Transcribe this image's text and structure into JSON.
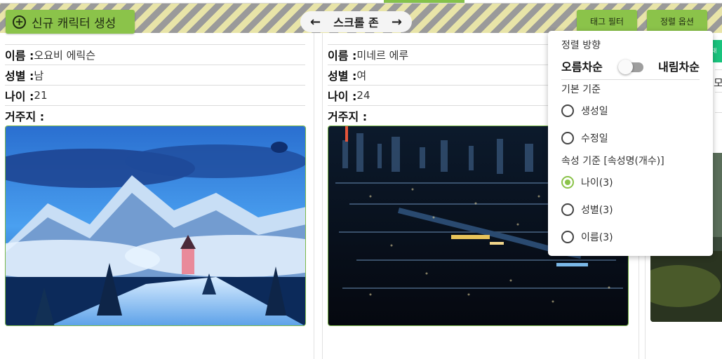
{
  "toolbar": {
    "new_character_label": "신규 캐릭터 생성",
    "scroll_zone_label": "스크롤 존",
    "tag_filter_label": "태그 필터",
    "sort_options_label": "정렬 옵션"
  },
  "cards": [
    {
      "name_label": "이름 :",
      "name_value": "오요비 에릭슨",
      "gender_label": "성별 :",
      "gender_value": "남",
      "age_label": "나이 :",
      "age_value": "21",
      "residence_label": "거주지 :",
      "residence_value": "",
      "image_desc": "snowy-mountain-chapel"
    },
    {
      "name_label": "이름 :",
      "name_value": "미네르 에루",
      "gender_label": "성별 :",
      "gender_value": "여",
      "age_label": "나이 :",
      "age_value": "24",
      "residence_label": "거주지 :",
      "residence_value": "",
      "image_desc": "night-city-skyline"
    }
  ],
  "card3": {
    "partial_text": "모"
  },
  "sort_menu": {
    "direction_title": "정렬 방향",
    "ascending_label": "오름차순",
    "descending_label": "내림차순",
    "descending_on": false,
    "basic_title": "기본 기준",
    "basic_options": [
      "생성일",
      "수정일"
    ],
    "attribute_title": "속성 기준 [속성명(개수)]",
    "attribute_options": [
      "나이(3)",
      "성별(3)",
      "이름(3)"
    ],
    "selected_option": "나이(3)"
  },
  "colors": {
    "accent": "#8bc34a",
    "badge": "#19c37d"
  }
}
